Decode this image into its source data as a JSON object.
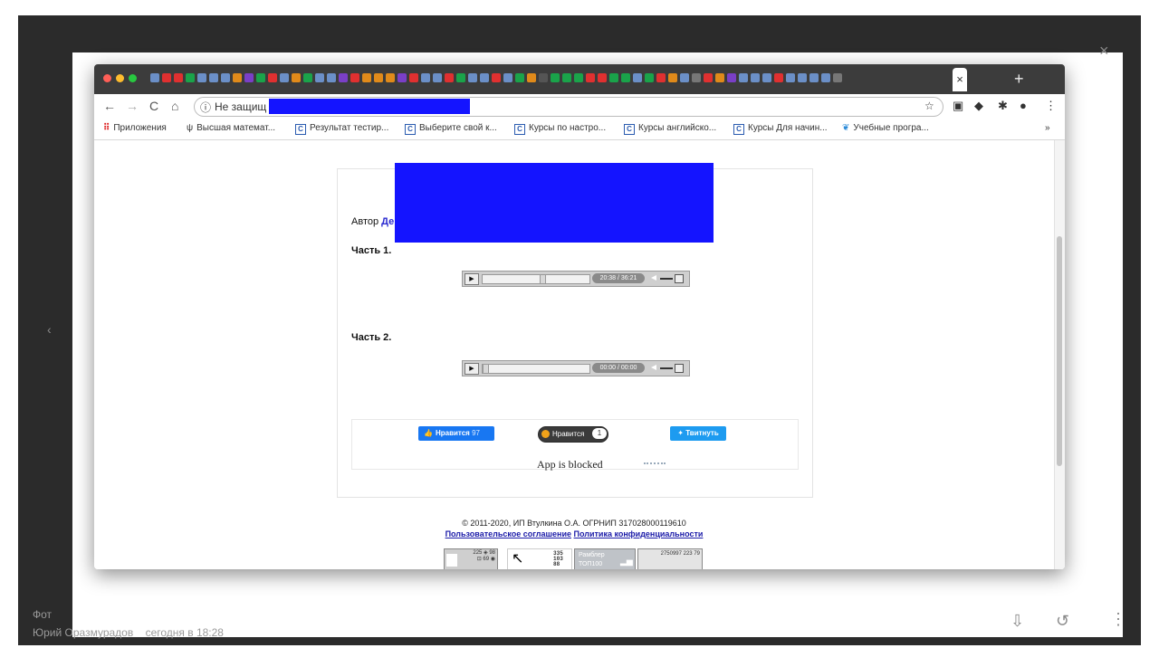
{
  "viewer": {
    "caption": "Фот",
    "author": "Юрий Оразмурадов",
    "time": "сегодня в 18:28"
  },
  "tabbar": {
    "active_tab_close": "×",
    "new_tab": "+",
    "icon_colors": [
      "#6b8fc7",
      "#e03030",
      "#e03030",
      "#1aa34a",
      "#6b8fc7",
      "#6b8fc7",
      "#6b8fc7",
      "#e08a1a",
      "#7a3fc7",
      "#1aa34a",
      "#e03030",
      "#6b8fc7",
      "#e08a1a",
      "#1aa34a",
      "#6b8fc7",
      "#6b8fc7",
      "#7a3fc7",
      "#e03030",
      "#e08a1a",
      "#e08a1a",
      "#e08a1a",
      "#7a3fc7",
      "#e03030",
      "#6b8fc7",
      "#6b8fc7",
      "#e03030",
      "#1aa34a",
      "#6b8fc7",
      "#6b8fc7",
      "#e03030",
      "#6b8fc7",
      "#1aa34a",
      "#e08a1a",
      "#555555",
      "#1aa34a",
      "#1aa34a",
      "#1aa34a",
      "#e03030",
      "#e03030",
      "#1aa34a",
      "#1aa34a",
      "#6b8fc7",
      "#1aa34a",
      "#e03030",
      "#e08a1a",
      "#6b8fc7",
      "#777777",
      "#e03030",
      "#e08a1a",
      "#7a3fc7",
      "#6b8fc7",
      "#6b8fc7",
      "#6b8fc7",
      "#e03030",
      "#6b8fc7",
      "#6b8fc7",
      "#6b8fc7",
      "#6b8fc7",
      "#777777"
    ]
  },
  "toolbar": {
    "back": "←",
    "forward": "→",
    "reload": "C",
    "home": "⌂",
    "info": "ⓘ",
    "url_label": "Не защищ",
    "star": "☆",
    "menu": "⋮"
  },
  "bookmarks": [
    {
      "icon": "apps-icon",
      "label": "Приложения"
    },
    {
      "icon": "site-icon",
      "label": "Высшая математ..."
    },
    {
      "icon": "c-icon",
      "label": "Результат тестир..."
    },
    {
      "icon": "c-icon",
      "label": "Выберите свой к..."
    },
    {
      "icon": "c-icon",
      "label": "Курсы по настро..."
    },
    {
      "icon": "c-icon",
      "label": "Курсы английско..."
    },
    {
      "icon": "c-icon",
      "label": "Курсы Для начин..."
    },
    {
      "icon": "leaf-icon",
      "label": "Учебные програ..."
    }
  ],
  "bookmarks_more": "»",
  "article": {
    "author_label": "Автор",
    "author_name": "Де",
    "part1": "Часть 1.",
    "part2": "Часть 2.",
    "player1": {
      "time": "20:38 / 36:21",
      "progress": 0.57
    },
    "player2": {
      "time": "00:00 / 00:00",
      "progress": 0.0
    }
  },
  "social": {
    "fb_label": "Нравится",
    "fb_count": "97",
    "ok_label": "Нравится",
    "ok_count": "1",
    "tw_label": "Твитнуть",
    "blocked": "App is blocked"
  },
  "footer": {
    "copyright": "© 2011-2020, ИП Втулкина О.А. ОГРНИП 317028000119610",
    "terms": "Пользовательское соглашение",
    "privacy": "Политика конфиденциальности"
  },
  "counters": {
    "c1": "225 ◈ 98 ⊡ 69 ◉",
    "c2": "335 103 88",
    "rambler": "Рамблер ТОП100",
    "liveinternet": "2750997 223 79"
  }
}
